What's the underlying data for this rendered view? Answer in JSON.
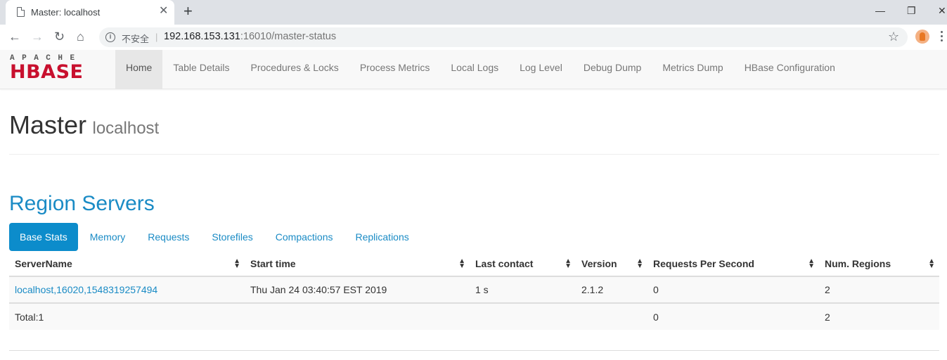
{
  "browser": {
    "tab_title": "Master: localhost",
    "new_tab": "+",
    "close": "✕",
    "insecure_label": "不安全",
    "separator": "|",
    "url_host": "192.168.153.131",
    "url_rest": ":16010/master-status",
    "win_minimize": "—",
    "win_restore": "❐",
    "win_close": "✕"
  },
  "logo": {
    "top": "APACHE",
    "bottom": "HBASE"
  },
  "nav": {
    "items": [
      "Home",
      "Table Details",
      "Procedures & Locks",
      "Process Metrics",
      "Local Logs",
      "Log Level",
      "Debug Dump",
      "Metrics Dump",
      "HBase Configuration"
    ],
    "active_index": 0
  },
  "header": {
    "title": "Master",
    "subtitle": "localhost"
  },
  "region_servers": {
    "title": "Region Servers",
    "tabs": [
      "Base Stats",
      "Memory",
      "Requests",
      "Storefiles",
      "Compactions",
      "Replications"
    ],
    "active_tab": 0,
    "columns": [
      "ServerName",
      "Start time",
      "Last contact",
      "Version",
      "Requests Per Second",
      "Num. Regions"
    ],
    "rows": [
      {
        "server": "localhost,16020,1548319257494",
        "start": "Thu Jan 24 03:40:57 EST 2019",
        "last_contact": "1 s",
        "version": "2.1.2",
        "rps": "0",
        "regions": "2"
      }
    ],
    "total": {
      "label": "Total:1",
      "rps": "0",
      "regions": "2"
    }
  },
  "colors": {
    "accent": "#0c8ccb",
    "link": "#1a8bc5",
    "logo_red": "#c8102e"
  }
}
